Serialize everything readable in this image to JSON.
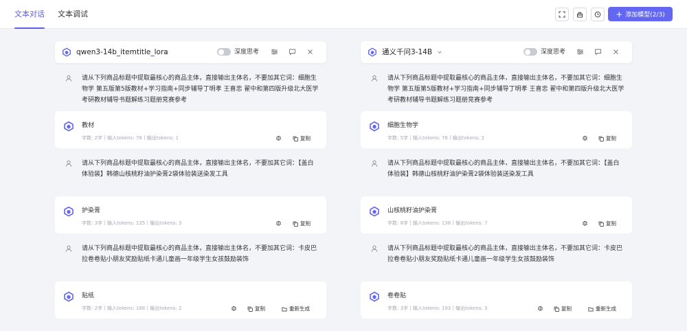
{
  "tabs": [
    {
      "label": "文本对话",
      "active": true
    },
    {
      "label": "文本调试",
      "active": false
    }
  ],
  "toolbar": {
    "icons": [
      "fullscreen-icon",
      "clear-icon",
      "history-icon"
    ],
    "add_model_label": "添加模型(2/3)",
    "accent": "#6366f1"
  },
  "columns": [
    {
      "model_name": "qwen3-14b_itemtitle_lora",
      "think_label": "深度思考",
      "messages": [
        {
          "user": "请从下列商品标题中提取最核心的商品主体，直接输出主体名，不要加其它词：细胞生物学 第五版第5版教材+学习指南+同步辅导丁明孝 王喜忠 翟中和第四版升级北大医学考研教材辅导书题解练习题册竞赛参考",
          "reply": "教材",
          "chars": "字数: 2字",
          "input_tokens": "输入tokens: 78",
          "output_tokens": "输出tokens: 1",
          "copy": "复制"
        },
        {
          "user": "请从下列商品标题中提取最核心的商品主体，直接输出主体名，不要加其它词：【盖白体验装】韩德山核桃籽油护染膏2袋体验装送染发工具",
          "reply": "护染膏",
          "chars": "字数: 3字",
          "input_tokens": "输入tokens: 135",
          "output_tokens": "输出tokens: 3",
          "copy": "复制"
        },
        {
          "user": "请从下列商品标题中提取最核心的商品主体，直接输出主体名，不要加其它词：卡皮巴拉卷卷贴小朋友奖励贴纸卡通儿童画一年级学生女孩鼓励装饰",
          "reply": "贴纸",
          "chars": "字数: 2字",
          "input_tokens": "输入tokens: 188",
          "output_tokens": "输出tokens: 2",
          "copy": "复制",
          "regenerate": "重新生成"
        }
      ]
    },
    {
      "model_name": "通义千问3-14B",
      "think_label": "深度思考",
      "messages": [
        {
          "user": "请从下列商品标题中提取最核心的商品主体，直接输出主体名，不要加其它词：细胞生物学 第五版第5版教材+学习指南+同步辅导丁明孝 王喜忠 翟中和第四版升级北大医学考研教材辅导书题解练习题册竞赛参考",
          "reply": "细胞生物学",
          "chars": "字数: 5字",
          "input_tokens": "输入tokens: 78",
          "output_tokens": "输出tokens: 2",
          "copy": "复制"
        },
        {
          "user": "请从下列商品标题中提取最核心的商品主体，直接输出主体名，不要加其它词：【盖白体验装】韩德山核桃籽油护染膏2袋体验装送染发工具",
          "reply": "山核桃籽油护染膏",
          "chars": "字数: 8字",
          "input_tokens": "输入tokens: 136",
          "output_tokens": "输出tokens: 7",
          "copy": "复制"
        },
        {
          "user": "请从下列商品标题中提取最核心的商品主体，直接输出主体名，不要加其它词：卡皮巴拉卷卷贴小朋友奖励贴纸卡通儿童画一年级学生女孩鼓励装饰",
          "reply": "卷卷贴",
          "chars": "字数: 3字",
          "input_tokens": "输入tokens: 193",
          "output_tokens": "输出tokens: 3",
          "copy": "复制",
          "regenerate": "重新生成"
        }
      ]
    }
  ]
}
